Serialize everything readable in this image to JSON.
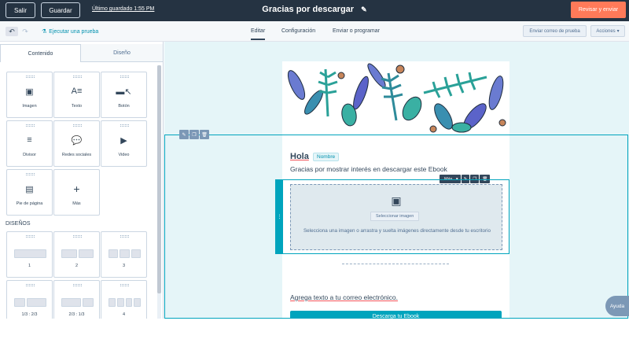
{
  "topbar": {
    "exit_label": "Salir",
    "save_label": "Guardar",
    "last_saved": "Último guardado 1:55 PM",
    "title": "Gracias por descargar",
    "send_label": "Revisar y enviar"
  },
  "subbar": {
    "run_test": "Ejecutar una prueba",
    "tabs": [
      "Editar",
      "Configuración",
      "Enviar o programar"
    ],
    "send_test": "Enviar correo de prueba",
    "actions": "Acciones"
  },
  "panel": {
    "tabs": [
      "Contenido",
      "Diseño"
    ],
    "modules": [
      {
        "label": "Imagen",
        "icon": "image-icon"
      },
      {
        "label": "Texto",
        "icon": "text-icon"
      },
      {
        "label": "Botón",
        "icon": "button-icon"
      },
      {
        "label": "Divisor",
        "icon": "divider-icon"
      },
      {
        "label": "Redes sociales",
        "icon": "social-icon"
      },
      {
        "label": "Video",
        "icon": "video-icon"
      },
      {
        "label": "Pie de página",
        "icon": "footer-icon"
      },
      {
        "label": "Más",
        "icon": "plus-icon"
      }
    ],
    "layouts_heading": "DISEÑOS",
    "layouts": [
      "1",
      "2",
      "3",
      "1/3 : 2/3",
      "2/3 : 1/3",
      "4"
    ]
  },
  "email": {
    "hello": "Hola",
    "token": "Nombre",
    "greeting": "Gracias por mostrar interés en descargar este Ebook",
    "more_label": "Más",
    "select_image": "Seleccionar imagen",
    "image_hint": "Selecciona una imagen o arrastra y suelta imágenes directamente desde tu escritorio",
    "body_text": "Agrega texto a tu correo electrónico.",
    "cta": "Descarga tu Ebook"
  },
  "help_label": "Ayuda",
  "colors": {
    "topbar": "#253342",
    "accent_orange": "#ff7a59",
    "accent_teal": "#00a4bd",
    "canvas": "#e5f5f8"
  }
}
